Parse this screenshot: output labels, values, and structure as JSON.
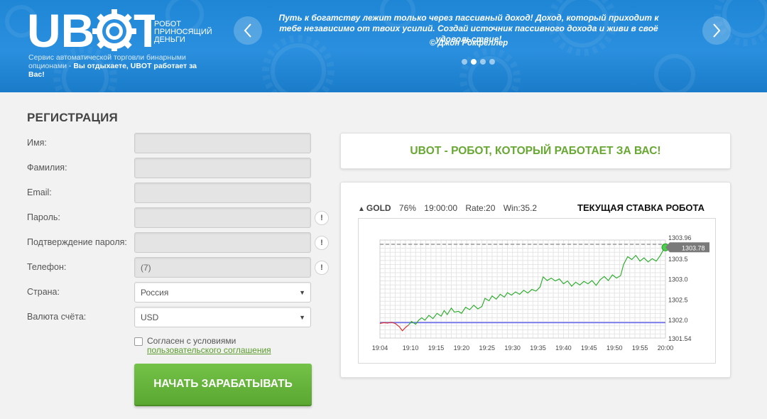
{
  "header": {
    "logo_text": "UBOT",
    "tagline": [
      "РОБОТ",
      "ПРИНОСЯЩИЙ",
      "ДЕНЬГИ"
    ],
    "subtitle_plain": "Сервис автоматической торговли бинарными опционами - ",
    "subtitle_bold": "Вы отдыхаете, UBOT работает за Вас!",
    "quote": "Путь к богатству лежит только через пассивный доход! Доход, который приходит к тебе независимо от твоих усилий. Создай источник пассивного дохода и живи в своё удовольствие!",
    "quote_author": "© Джон Рокфеллер",
    "slider_total": 4,
    "slider_active": 2,
    "left_arrow_icon": "chevron-left-icon",
    "right_arrow_icon": "chevron-right-icon"
  },
  "registration": {
    "title": "РЕГИСТРАЦИЯ",
    "fields": [
      {
        "label": "Имя:",
        "value": ""
      },
      {
        "label": "Фамилия:",
        "value": ""
      },
      {
        "label": "Email:",
        "value": ""
      },
      {
        "label": "Пароль:",
        "value": "",
        "hint": "!"
      },
      {
        "label": "Подтверждение пароля:",
        "value": "",
        "hint": "!"
      },
      {
        "label": "Телефон:",
        "value": "(7)",
        "hint": "!"
      },
      {
        "label": "Страна:",
        "value": "Россия"
      },
      {
        "label": "Валюта счёта:",
        "value": "USD"
      }
    ],
    "agree_line1": "Согласен с условиями",
    "agree_link": "пользовательского соглашения",
    "agree_checked": false,
    "submit_label": "НАЧАТЬ ЗАРАБАТЫВАТЬ"
  },
  "banner": {
    "text": "UBOT - РОБОТ, КОТОРЫЙ РАБОТАЕТ ЗА ВАС!"
  },
  "rate_panel": {
    "direction_icon": "triangle-up-icon",
    "symbol": "GOLD",
    "percent": "76%",
    "time": "19:00:00",
    "rate": "Rate:20",
    "win": "Win:35.2",
    "title": "ТЕКУЩАЯ СТАВКА РОБОТА"
  },
  "colors": {
    "header_blue": "#2a8fde",
    "accent_green": "#67a832",
    "button_green": "#5aa732",
    "line_green": "#22aa22",
    "line_red": "#dd2222",
    "baseline_blue": "#6b6bf0",
    "price_tag_gray": "#7a7a7a"
  },
  "chart_data": {
    "type": "line",
    "x_ticks": [
      "19:04",
      "19:10",
      "19:15",
      "19:20",
      "19:25",
      "19:30",
      "19:35",
      "19:40",
      "19:45",
      "19:50",
      "19:55",
      "20:00"
    ],
    "y_ticks": [
      1301.54,
      1302.0,
      1302.5,
      1303.0,
      1303.5,
      1303.96
    ],
    "ylim": [
      1301.54,
      1303.96
    ],
    "xlim_minutes": [
      0,
      56
    ],
    "current_price": 1303.78,
    "reference_level": 1303.96,
    "baseline_level": 1301.92,
    "series": [
      {
        "color": "red",
        "points": [
          [
            0,
            1301.9
          ],
          [
            0.8,
            1301.92
          ],
          [
            1.5,
            1301.91
          ],
          [
            2.2,
            1301.93
          ],
          [
            3.0,
            1301.9
          ],
          [
            3.8,
            1301.82
          ],
          [
            4.4,
            1301.72
          ],
          [
            5.0,
            1301.8
          ],
          [
            5.6,
            1301.86
          ]
        ]
      },
      {
        "color": "green",
        "points": [
          [
            5.6,
            1301.86
          ],
          [
            6.2,
            1301.95
          ],
          [
            7.0,
            1301.88
          ],
          [
            7.6,
            1301.98
          ],
          [
            8.2,
            1302.04
          ],
          [
            8.8,
            1301.98
          ],
          [
            9.6,
            1302.1
          ],
          [
            10.4,
            1302.02
          ],
          [
            11.2,
            1302.15
          ],
          [
            12.0,
            1302.08
          ],
          [
            12.6,
            1302.22
          ],
          [
            13.2,
            1302.12
          ],
          [
            14.0,
            1302.28
          ],
          [
            14.6,
            1302.18
          ],
          [
            15.4,
            1302.2
          ],
          [
            16.0,
            1302.15
          ],
          [
            16.8,
            1302.3
          ],
          [
            17.6,
            1302.24
          ],
          [
            18.4,
            1302.35
          ],
          [
            19.2,
            1302.26
          ],
          [
            20.0,
            1302.32
          ],
          [
            20.6,
            1302.52
          ],
          [
            21.4,
            1302.46
          ],
          [
            22.0,
            1302.58
          ],
          [
            22.8,
            1302.5
          ],
          [
            23.6,
            1302.62
          ],
          [
            24.4,
            1302.55
          ],
          [
            25.0,
            1302.66
          ],
          [
            25.8,
            1302.6
          ],
          [
            26.6,
            1302.68
          ],
          [
            27.4,
            1302.62
          ],
          [
            28.2,
            1302.72
          ],
          [
            29.0,
            1302.65
          ],
          [
            29.8,
            1302.74
          ],
          [
            30.6,
            1302.7
          ],
          [
            31.4,
            1302.8
          ],
          [
            32.0,
            1303.05
          ],
          [
            32.8,
            1302.96
          ],
          [
            33.6,
            1303.02
          ],
          [
            34.4,
            1302.95
          ],
          [
            35.2,
            1303.0
          ],
          [
            36.0,
            1302.88
          ],
          [
            36.8,
            1302.95
          ],
          [
            37.6,
            1302.82
          ],
          [
            38.4,
            1302.92
          ],
          [
            39.2,
            1302.85
          ],
          [
            40.0,
            1302.94
          ],
          [
            40.8,
            1302.88
          ],
          [
            41.6,
            1302.96
          ],
          [
            42.4,
            1302.84
          ],
          [
            43.2,
            1302.98
          ],
          [
            44.0,
            1303.06
          ],
          [
            44.8,
            1302.96
          ],
          [
            45.6,
            1303.1
          ],
          [
            46.4,
            1303.02
          ],
          [
            47.2,
            1303.08
          ],
          [
            47.8,
            1303.36
          ],
          [
            48.6,
            1303.55
          ],
          [
            49.4,
            1303.48
          ],
          [
            50.2,
            1303.58
          ],
          [
            51.0,
            1303.44
          ],
          [
            51.8,
            1303.52
          ],
          [
            52.6,
            1303.42
          ],
          [
            53.4,
            1303.5
          ],
          [
            54.2,
            1303.44
          ],
          [
            55.0,
            1303.58
          ],
          [
            55.6,
            1303.72
          ],
          [
            56.0,
            1303.78
          ]
        ]
      }
    ]
  }
}
